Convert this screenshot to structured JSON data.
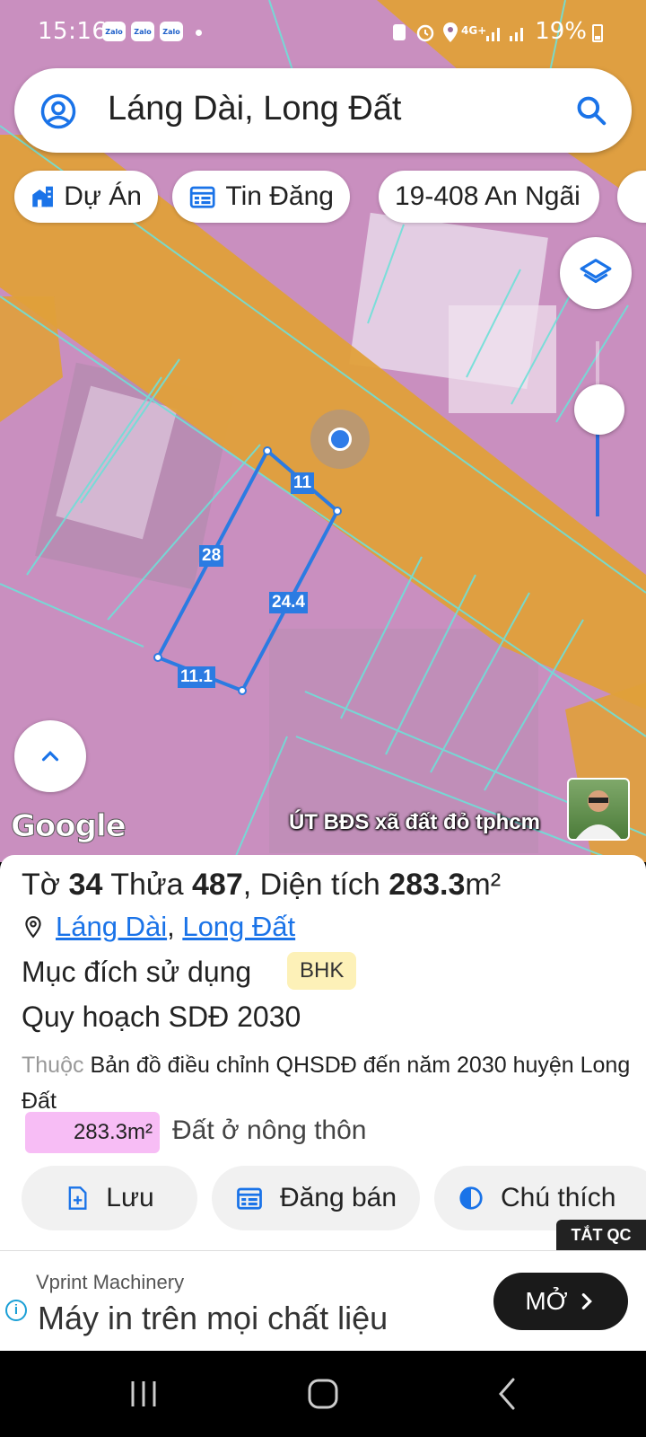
{
  "status_bar": {
    "time": "15:16",
    "app_icons": [
      "Zalo",
      "Zalo",
      "Zalo"
    ],
    "network": "4G+",
    "battery": "19%"
  },
  "search": {
    "query": "Láng Dài, Long Đất"
  },
  "chips": [
    {
      "label": "Dự Án",
      "icon": "building-icon"
    },
    {
      "label": "Tin Đăng",
      "icon": "listing-icon"
    },
    {
      "label": "19-408 An Ngãi",
      "icon": ""
    }
  ],
  "map": {
    "edge_lengths": [
      "11",
      "28",
      "24.4",
      "11.1"
    ],
    "google_label": "Google",
    "watermark": "ÚT BĐS xã đất đỏ tphcm",
    "colors": {
      "land": "#d39ac9",
      "road": "#e8a23a",
      "parcel_outline": "#2b7be2",
      "grid": "#6fe0d8"
    }
  },
  "parcel": {
    "sheet_label": "Tờ",
    "sheet_no": "34",
    "lot_label": "Thửa",
    "lot_no": "487",
    "area_label": ", Diện tích",
    "area_value": "283.3",
    "area_unit": "m²",
    "location_1": "Láng Dài",
    "location_2": "Long Đất",
    "purpose_label": "Mục đích sử dụng",
    "purpose_code": "BHK",
    "plan_title": "Quy hoạch SDĐ 2030",
    "belongs_label": "Thuộc",
    "plan_desc": "Bản đồ điều chỉnh QHSDĐ đến năm 2030 huyện Long Đất",
    "plan_area": "283.3m²",
    "plan_land_type": "Đất ở nông thôn"
  },
  "actions": {
    "save": "Lưu",
    "post_sale": "Đăng bán",
    "legend": "Chú thích"
  },
  "ad": {
    "off_label": "TẮT QC",
    "advertiser": "Vprint Machinery",
    "headline": "Máy in trên mọi chất liệu",
    "open_label": "MỞ"
  }
}
